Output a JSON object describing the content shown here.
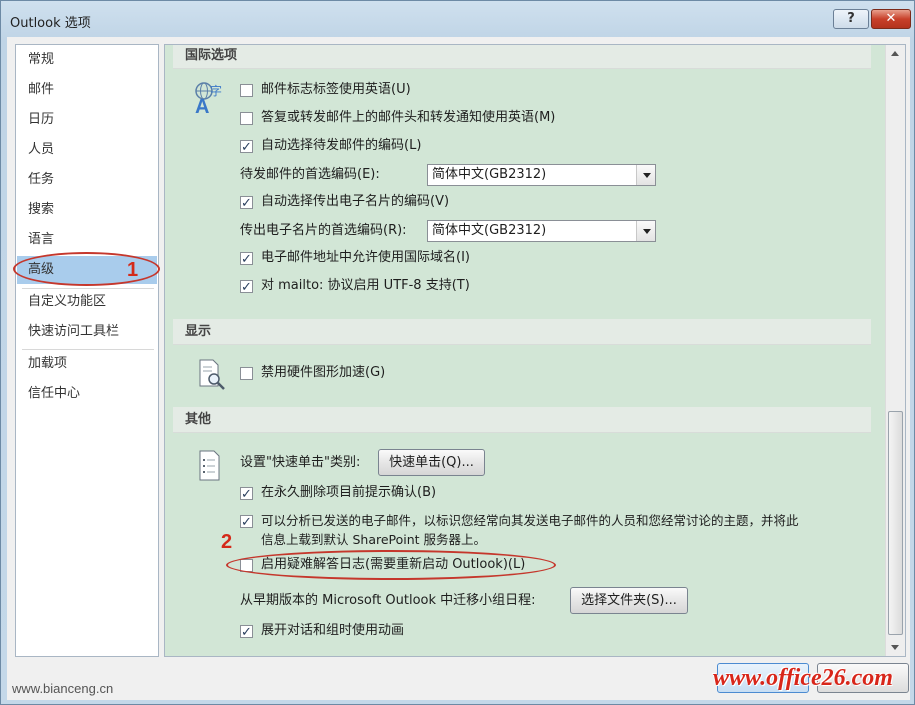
{
  "window": {
    "title": "Outlook 选项",
    "help_label": "?",
    "close_label": "✕"
  },
  "nav": {
    "items": [
      {
        "label": "常规"
      },
      {
        "label": "邮件"
      },
      {
        "label": "日历"
      },
      {
        "label": "人员"
      },
      {
        "label": "任务"
      },
      {
        "label": "搜索"
      },
      {
        "label": "语言"
      },
      {
        "label": "高级",
        "selected": true
      },
      {
        "label": "自定义功能区"
      },
      {
        "label": "快速访问工具栏"
      },
      {
        "label": "加载项"
      },
      {
        "label": "信任中心"
      }
    ]
  },
  "sections": {
    "intl": {
      "title": "国际选项",
      "icon": "globe-language-icon",
      "opt1": {
        "label": "邮件标志标签使用英语(U)",
        "checked": false
      },
      "opt2": {
        "label": "答复或转发邮件上的邮件头和转发通知使用英语(M)",
        "checked": false
      },
      "opt3": {
        "label": "自动选择待发邮件的编码(L)",
        "checked": true
      },
      "enc1_label": "待发邮件的首选编码(E):",
      "enc1_value": "简体中文(GB2312)",
      "opt4": {
        "label": "自动选择传出电子名片的编码(V)",
        "checked": true
      },
      "enc2_label": "传出电子名片的首选编码(R):",
      "enc2_value": "简体中文(GB2312)",
      "opt5": {
        "label": "电子邮件地址中允许使用国际域名(I)",
        "checked": true
      },
      "opt6": {
        "label": "对 mailto: 协议启用 UTF-8 支持(T)",
        "checked": true
      }
    },
    "display": {
      "title": "显示",
      "icon": "magnifier-document-icon",
      "opt1": {
        "label": "禁用硬件图形加速(G)",
        "checked": false
      }
    },
    "other": {
      "title": "其他",
      "icon": "list-document-icon",
      "quickclick_label": "设置\"快速单击\"类别:",
      "quickclick_button": "快速单击(Q)...",
      "opt1": {
        "label": "在永久删除项目前提示确认(B)",
        "checked": true
      },
      "opt2_line1": "可以分析已发送的电子邮件，以标识您经常向其发送电子邮件的人员和您经常讨论的主题，并将此",
      "opt2_line2": "信息上载到默认 SharePoint 服务器上。",
      "opt2_checked": true,
      "opt3": {
        "label": "启用疑难解答日志(需要重新启动 Outlook)(L)",
        "checked": false
      },
      "migrate_label": "从早期版本的 Microsoft Outlook 中迁移小组日程:",
      "migrate_button": "选择文件夹(S)...",
      "opt4": {
        "label": "展开对话和组时使用动画",
        "checked": true
      }
    }
  },
  "annotations": {
    "num1": "1",
    "num2": "2"
  },
  "watermarks": {
    "left": "www.bianceng.cn",
    "right": "www.office26.com"
  },
  "colors": {
    "annotation": "#d42a1a",
    "selected_nav": "#a9ccec",
    "content_bg": "#d2e6d6"
  }
}
